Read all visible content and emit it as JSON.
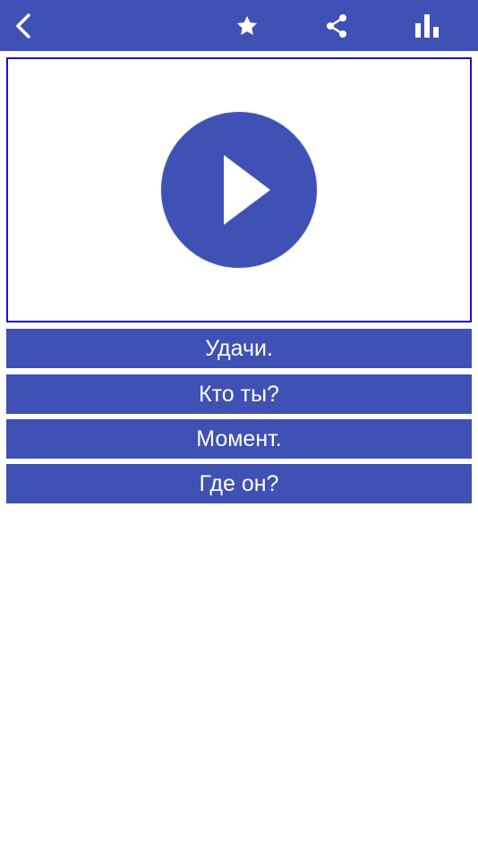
{
  "colors": {
    "primary": "#3f51b5",
    "video_border": "#1a0fd6",
    "background": "#ffffff",
    "text_on_primary": "#ffffff"
  },
  "toolbar": {
    "icons": [
      "chevron-left-icon",
      "star-icon",
      "share-icon",
      "bar-chart-icon"
    ]
  },
  "video": {
    "icon": "play-icon"
  },
  "answers": [
    {
      "label": "Удачи."
    },
    {
      "label": "Кто ты?"
    },
    {
      "label": "Момент."
    },
    {
      "label": "Где он?"
    }
  ]
}
